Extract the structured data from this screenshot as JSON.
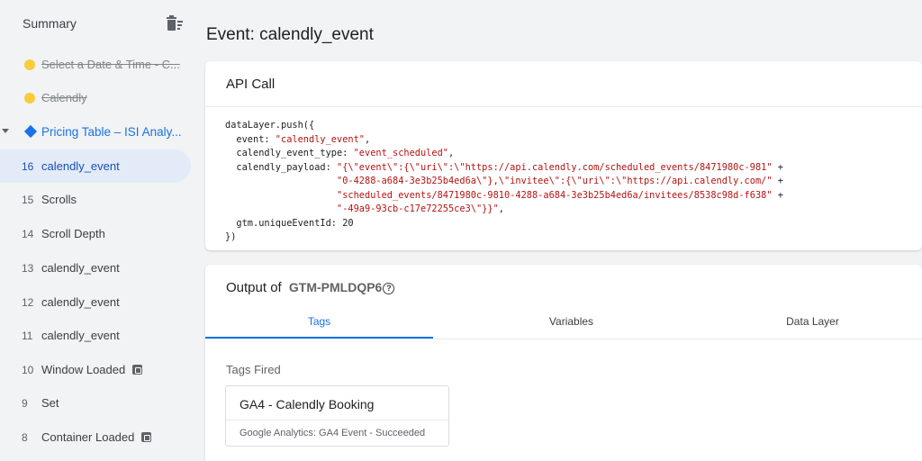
{
  "sidebar": {
    "title": "Summary",
    "items": [
      {
        "label": "Select a Date & Time - C...",
        "style": "struck",
        "icon": "yellow-dot"
      },
      {
        "label": "Calendly",
        "style": "struck",
        "icon": "yellow-dot"
      },
      {
        "label": "Pricing Table – ISI Analy...",
        "style": "group",
        "icon": "blue-diamond"
      },
      {
        "num": "16",
        "label": "calendly_event",
        "selected": true
      },
      {
        "num": "15",
        "label": "Scrolls"
      },
      {
        "num": "14",
        "label": "Scroll Depth"
      },
      {
        "num": "13",
        "label": "calendly_event"
      },
      {
        "num": "12",
        "label": "calendly_event"
      },
      {
        "num": "11",
        "label": "calendly_event"
      },
      {
        "num": "10",
        "label": "Window Loaded",
        "badge": true
      },
      {
        "num": "9",
        "label": "Set"
      },
      {
        "num": "8",
        "label": "Container Loaded",
        "badge": true
      }
    ]
  },
  "main": {
    "title": "Event: calendly_event",
    "api_call": {
      "title": "API Call",
      "code": {
        "open": "dataLayer.push({",
        "event_key": "  event: ",
        "event_val": "\"calendly_event\"",
        "type_key": "  calendly_event_type: ",
        "type_val": "\"event_scheduled\"",
        "payload_key": "  calendly_payload: ",
        "payload_lines": [
          "\"{\\\"event\\\":{\\\"uri\\\":\\\"https://api.calendly.com/scheduled_events/8471980c-981\"",
          "\"0-4288-a684-3e3b25b4ed6a\\\"},\\\"invitee\\\":{\\\"uri\\\":\\\"https://api.calendly.com/\"",
          "\"scheduled_events/8471980c-9810-4288-a684-3e3b25b4ed6a/invitees/8538c98d-f638\"",
          "\"-49a9-93cb-c17e72255ce3\\\"}}\""
        ],
        "id_key": "  gtm.uniqueEventId: ",
        "id_val": "20",
        "close": "})"
      }
    },
    "output": {
      "title": "Output of",
      "container_id": "GTM-PMLDQP6",
      "tabs": [
        "Tags",
        "Variables",
        "Data Layer"
      ],
      "active_tab": "Tags",
      "tags_fired_label": "Tags Fired",
      "tags": [
        {
          "name": "GA4 - Calendly Booking",
          "status": "Google Analytics: GA4 Event - Succeeded"
        }
      ]
    }
  },
  "colors": {
    "accent": "#1a73e8",
    "selected_bg": "#e3ebf8",
    "string": "#b31412",
    "yellow_dot": "#f8cc3a"
  },
  "icons": {
    "delete": "delete-sweep-icon",
    "help": "help-circle-icon",
    "badge": "container-badge-icon"
  }
}
